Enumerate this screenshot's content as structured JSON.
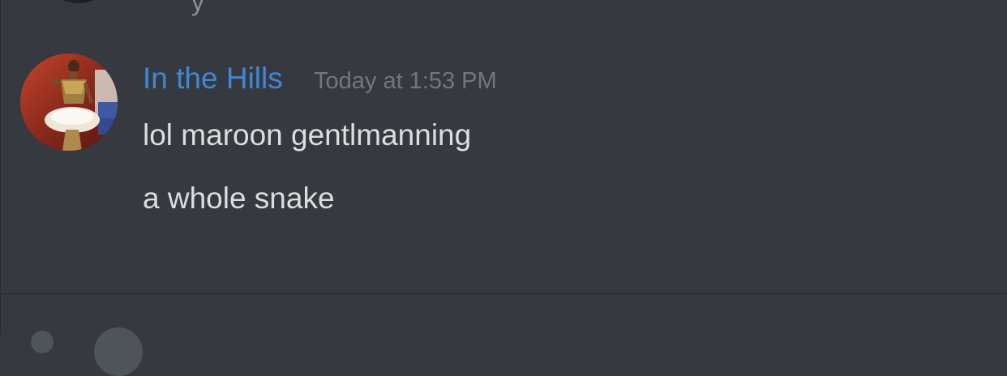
{
  "previous_message": {
    "partial_text": "y"
  },
  "message": {
    "author": "In the Hills",
    "timestamp": "Today at 1:53 PM",
    "lines": [
      "lol maroon gentlmanning",
      "a whole snake"
    ]
  },
  "colors": {
    "background": "#36393f",
    "username": "#3f88d6",
    "timestamp": "#72767d",
    "message_text": "#dcddde"
  },
  "icons": {
    "avatar": "user-avatar-photo",
    "composer_left": "attachment-icon",
    "composer_right": "emoji-icon"
  }
}
